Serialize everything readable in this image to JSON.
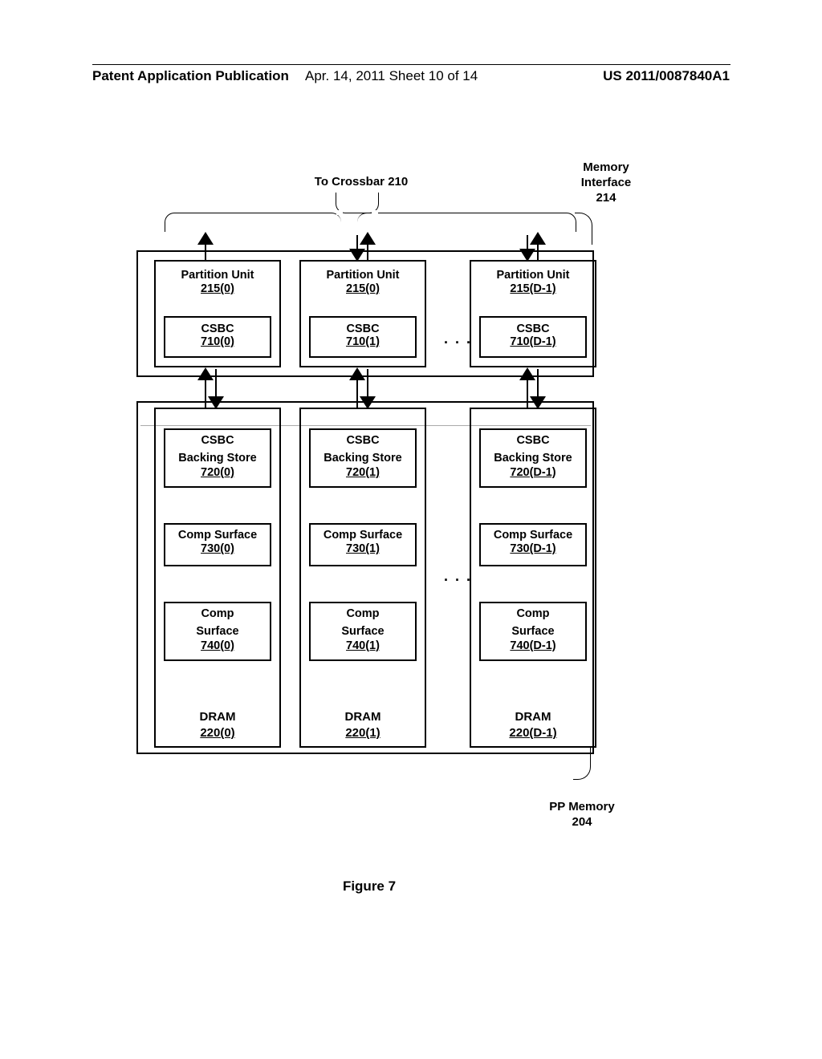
{
  "header": {
    "left": "Patent Application Publication",
    "mid": "Apr. 14, 2011  Sheet 10 of 14",
    "right": "US 2011/0087840A1"
  },
  "labels": {
    "crossbar": "To Crossbar 210",
    "memory_interface_line1": "Memory",
    "memory_interface_line2": "Interface",
    "memory_interface_line3": "214",
    "pp_memory_line1": "PP Memory",
    "pp_memory_line2": "204",
    "figure": "Figure 7",
    "partition_unit": "Partition Unit",
    "csbc": "CSBC",
    "csbc_backing_line1": "CSBC",
    "csbc_backing_line2": "Backing Store",
    "comp_surface": "Comp Surface",
    "comp_line1": "Comp",
    "comp_line2": "Surface",
    "dram": "DRAM",
    "ellipsis": ". . ."
  },
  "cols": [
    {
      "pu_id": "215(0)",
      "csbc_id": "710(0)",
      "backing_id": "720(0)",
      "surface1_id": "730(0)",
      "surface2_id": "740(0)",
      "dram_id": "220(0)"
    },
    {
      "pu_id": "215(0)",
      "csbc_id": "710(1)",
      "backing_id": "720(1)",
      "surface1_id": "730(1)",
      "surface2_id": "740(1)",
      "dram_id": "220(1)"
    },
    {
      "pu_id": "215(D-1)",
      "csbc_id": "710(D-1)",
      "backing_id": "720(D-1)",
      "surface1_id": "730(D-1)",
      "surface2_id": "740(D-1)",
      "dram_id": "220(D-1)"
    }
  ]
}
